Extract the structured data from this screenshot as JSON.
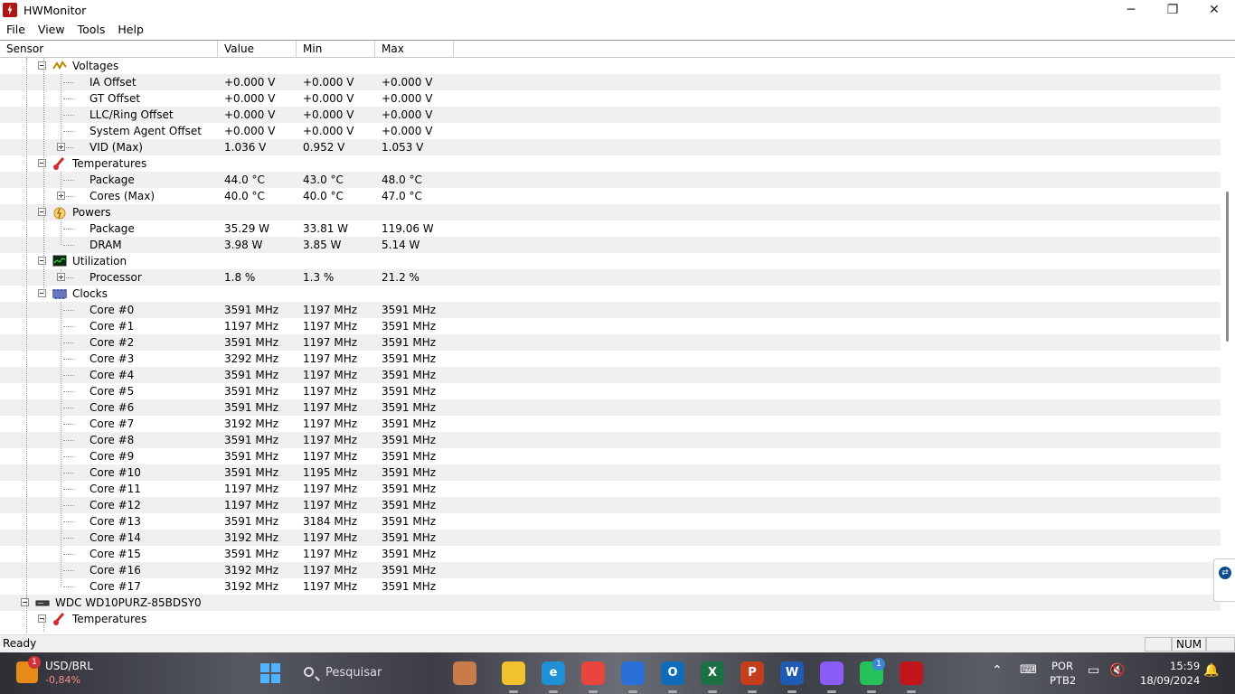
{
  "window": {
    "title": "HWMonitor",
    "controls": {
      "minimize": "─",
      "maximize": "❐",
      "close": "✕"
    }
  },
  "menu": [
    "File",
    "View",
    "Tools",
    "Help"
  ],
  "columns": {
    "sensor": "Sensor",
    "value": "Value",
    "min": "Min",
    "max": "Max"
  },
  "rows": [
    {
      "type": "group",
      "level": 2,
      "label": "Voltages",
      "icon": "voltage-icon",
      "expander": "minus"
    },
    {
      "type": "item",
      "level": 3,
      "label": "IA Offset",
      "value": "+0.000 V",
      "min": "+0.000 V",
      "max": "+0.000 V"
    },
    {
      "type": "item",
      "level": 3,
      "label": "GT Offset",
      "value": "+0.000 V",
      "min": "+0.000 V",
      "max": "+0.000 V"
    },
    {
      "type": "item",
      "level": 3,
      "label": "LLC/Ring Offset",
      "value": "+0.000 V",
      "min": "+0.000 V",
      "max": "+0.000 V"
    },
    {
      "type": "item",
      "level": 3,
      "label": "System Agent Offset",
      "value": "+0.000 V",
      "min": "+0.000 V",
      "max": "+0.000 V"
    },
    {
      "type": "item",
      "level": 3,
      "label": "VID (Max)",
      "value": "1.036 V",
      "min": "0.952 V",
      "max": "1.053 V",
      "expander": "plus"
    },
    {
      "type": "group",
      "level": 2,
      "label": "Temperatures",
      "icon": "thermometer-icon",
      "expander": "minus"
    },
    {
      "type": "item",
      "level": 3,
      "label": "Package",
      "value": "44.0 °C",
      "min": "43.0 °C",
      "max": "48.0 °C"
    },
    {
      "type": "item",
      "level": 3,
      "label": "Cores (Max)",
      "value": "40.0 °C",
      "min": "40.0 °C",
      "max": "47.0 °C",
      "expander": "plus"
    },
    {
      "type": "group",
      "level": 2,
      "label": "Powers",
      "icon": "power-icon",
      "expander": "minus"
    },
    {
      "type": "item",
      "level": 3,
      "label": "Package",
      "value": "35.29 W",
      "min": "33.81 W",
      "max": "119.06 W"
    },
    {
      "type": "item",
      "level": 3,
      "label": "DRAM",
      "value": "3.98 W",
      "min": "3.85 W",
      "max": "5.14 W"
    },
    {
      "type": "group",
      "level": 2,
      "label": "Utilization",
      "icon": "utilization-icon",
      "expander": "minus"
    },
    {
      "type": "item",
      "level": 3,
      "label": "Processor",
      "value": "1.8 %",
      "min": "1.3 %",
      "max": "21.2 %",
      "expander": "plus"
    },
    {
      "type": "group",
      "level": 2,
      "label": "Clocks",
      "icon": "clock-icon",
      "expander": "minus"
    },
    {
      "type": "item",
      "level": 3,
      "label": "Core #0",
      "value": "3591 MHz",
      "min": "1197 MHz",
      "max": "3591 MHz"
    },
    {
      "type": "item",
      "level": 3,
      "label": "Core #1",
      "value": "1197 MHz",
      "min": "1197 MHz",
      "max": "3591 MHz"
    },
    {
      "type": "item",
      "level": 3,
      "label": "Core #2",
      "value": "3591 MHz",
      "min": "1197 MHz",
      "max": "3591 MHz"
    },
    {
      "type": "item",
      "level": 3,
      "label": "Core #3",
      "value": "3292 MHz",
      "min": "1197 MHz",
      "max": "3591 MHz"
    },
    {
      "type": "item",
      "level": 3,
      "label": "Core #4",
      "value": "3591 MHz",
      "min": "1197 MHz",
      "max": "3591 MHz"
    },
    {
      "type": "item",
      "level": 3,
      "label": "Core #5",
      "value": "3591 MHz",
      "min": "1197 MHz",
      "max": "3591 MHz"
    },
    {
      "type": "item",
      "level": 3,
      "label": "Core #6",
      "value": "3591 MHz",
      "min": "1197 MHz",
      "max": "3591 MHz"
    },
    {
      "type": "item",
      "level": 3,
      "label": "Core #7",
      "value": "3192 MHz",
      "min": "1197 MHz",
      "max": "3591 MHz"
    },
    {
      "type": "item",
      "level": 3,
      "label": "Core #8",
      "value": "3591 MHz",
      "min": "1197 MHz",
      "max": "3591 MHz"
    },
    {
      "type": "item",
      "level": 3,
      "label": "Core #9",
      "value": "3591 MHz",
      "min": "1197 MHz",
      "max": "3591 MHz"
    },
    {
      "type": "item",
      "level": 3,
      "label": "Core #10",
      "value": "3591 MHz",
      "min": "1195 MHz",
      "max": "3591 MHz"
    },
    {
      "type": "item",
      "level": 3,
      "label": "Core #11",
      "value": "1197 MHz",
      "min": "1197 MHz",
      "max": "3591 MHz"
    },
    {
      "type": "item",
      "level": 3,
      "label": "Core #12",
      "value": "1197 MHz",
      "min": "1197 MHz",
      "max": "3591 MHz"
    },
    {
      "type": "item",
      "level": 3,
      "label": "Core #13",
      "value": "3591 MHz",
      "min": "3184 MHz",
      "max": "3591 MHz"
    },
    {
      "type": "item",
      "level": 3,
      "label": "Core #14",
      "value": "3192 MHz",
      "min": "1197 MHz",
      "max": "3591 MHz"
    },
    {
      "type": "item",
      "level": 3,
      "label": "Core #15",
      "value": "3591 MHz",
      "min": "1197 MHz",
      "max": "3591 MHz"
    },
    {
      "type": "item",
      "level": 3,
      "label": "Core #16",
      "value": "3192 MHz",
      "min": "1197 MHz",
      "max": "3591 MHz"
    },
    {
      "type": "item",
      "level": 3,
      "label": "Core #17",
      "value": "3192 MHz",
      "min": "1197 MHz",
      "max": "3591 MHz"
    },
    {
      "type": "group",
      "level": 1,
      "label": "WDC WD10PURZ-85BDSY0",
      "icon": "hard-drive-icon",
      "expander": "minus"
    },
    {
      "type": "group",
      "level": 2,
      "label": "Temperatures",
      "icon": "thermometer-icon",
      "expander": "minus"
    }
  ],
  "status": {
    "text": "Ready",
    "num": "NUM"
  },
  "taskbar": {
    "stock": {
      "name": "USD/BRL",
      "change": "-0,84%",
      "badge": "1"
    },
    "search_placeholder": "Pesquisar",
    "apps": [
      {
        "name": "character-app-icon",
        "letter": "",
        "color": "#c97b4a"
      },
      {
        "name": "file-explorer-icon",
        "letter": "",
        "color": "#f2c12e"
      },
      {
        "name": "edge-icon",
        "letter": "e",
        "color": "#1f8fd6"
      },
      {
        "name": "chrome-icon",
        "letter": "",
        "color": "#e8453c"
      },
      {
        "name": "store-icon",
        "letter": "",
        "color": "#2a6fd6"
      },
      {
        "name": "outlook-icon",
        "letter": "O",
        "color": "#0f6cbd"
      },
      {
        "name": "excel-icon",
        "letter": "X",
        "color": "#1d7044"
      },
      {
        "name": "powerpoint-icon",
        "letter": "P",
        "color": "#c43e1c"
      },
      {
        "name": "word-icon",
        "letter": "W",
        "color": "#1f5bb5"
      },
      {
        "name": "copilot-icon",
        "letter": "",
        "color": "#8a5cf6"
      },
      {
        "name": "whatsapp-icon",
        "letter": "",
        "color": "#25c25a"
      },
      {
        "name": "hwmonitor-icon",
        "letter": "",
        "color": "#c0161b"
      }
    ],
    "whatsapp_badge": "1",
    "language": "POR",
    "layout": "PTB2",
    "time": "15:59",
    "date": "18/09/2024"
  }
}
